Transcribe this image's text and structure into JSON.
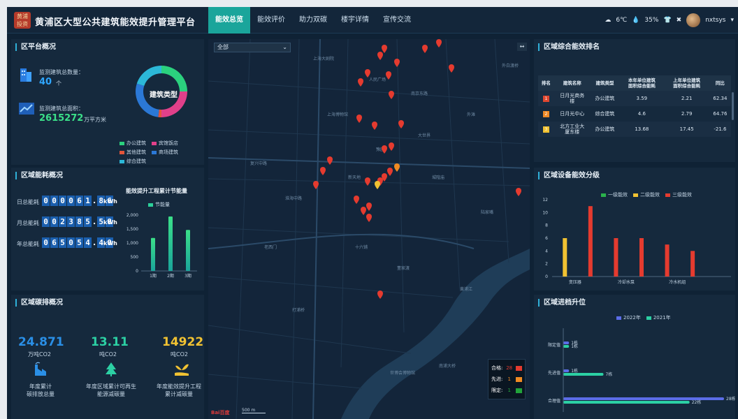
{
  "header": {
    "logo_text": "黄浦\n投资",
    "title": "黄浦区大型公共建筑能效提升管理平台",
    "nav": [
      "能效总览",
      "能效评价",
      "助力双碳",
      "楼宇详情",
      "宣传交流"
    ],
    "weather": "6℃",
    "humidity": "35%",
    "username": "nxtsys"
  },
  "overview": {
    "title": "区平台概况",
    "building_count_label": "监测建筑总数量：",
    "building_count": "40",
    "building_count_unit": "个",
    "area_label": "监测建筑总面积：",
    "area": "2615272",
    "area_unit": "万平方米",
    "donut_label": "建筑类型",
    "donut": [
      {
        "name": "办公建筑",
        "value": 25,
        "color": "#2bd17e"
      },
      {
        "name": "宾馆饭店",
        "value": 25,
        "color": "#e0408a"
      },
      {
        "name": "其他建筑",
        "value": 2,
        "color": "#e2553a"
      },
      {
        "name": "商场建筑",
        "value": 28,
        "color": "#2b78d6"
      },
      {
        "name": "综合建筑",
        "value": 20,
        "color": "#2cb8d8"
      }
    ]
  },
  "energy": {
    "title": "区域能耗概况",
    "daily_label": "日总能耗",
    "daily": "000061.86",
    "monthly_label": "月总能耗",
    "monthly": "002385.58",
    "yearly_label": "年总能耗",
    "yearly": "065054.40",
    "unit": "kWh",
    "chart_title": "能效提升工程累计节能量",
    "legend": "节能量"
  },
  "carbon": {
    "title": "区域碳排概况",
    "items": [
      {
        "value": "24.871",
        "unit": "万吨CO2",
        "label": "年度累计\n碳排放总量",
        "color": "#2a8fe6"
      },
      {
        "value": "13.11",
        "unit": "吨CO2",
        "label": "年度区域累计可再生\n能源减碳量",
        "color": "#2cd0a4"
      },
      {
        "value": "14922",
        "unit": "吨CO2",
        "label": "年度能效提升工程\n累计减碳量",
        "color": "#f1c232"
      }
    ]
  },
  "map": {
    "select_value": "全部",
    "legend": [
      {
        "label": "合格:",
        "count": "28",
        "color": "#e53b2f"
      },
      {
        "label": "先进:",
        "count": "1",
        "color": "#f08a22"
      },
      {
        "label": "限定:",
        "count": "1",
        "color": "#21a33a"
      }
    ],
    "scale_label": "500 m",
    "labels": [
      "上海大剧院",
      "人民广场",
      "南京东路",
      "外滩",
      "豫园",
      "新天地",
      "淮海中路",
      "陆家嘴",
      "黄浦江",
      "世博会博物馆",
      "大世界",
      "上海博物馆",
      "老西门",
      "打浦桥",
      "董家渡",
      "南浦大桥",
      "复兴中路",
      "城隍庙",
      "十六铺",
      "外白渡桥"
    ]
  },
  "ranking": {
    "title": "区域综合能效排名",
    "columns": [
      "排名",
      "建筑名称",
      "建筑类型",
      "本年单位建筑\n面积综合能耗",
      "上年单位建筑\n面积综合能耗",
      "同比"
    ],
    "rows": [
      {
        "rank": "1",
        "name": "日月光商务\n楼",
        "type": "办公建筑",
        "this_year": "3.59",
        "last_year": "2.21",
        "yoy": "62.34",
        "color": "#e0472f"
      },
      {
        "rank": "2",
        "name": "日月光中心",
        "type": "综合建筑",
        "this_year": "4.6",
        "last_year": "2.79",
        "yoy": "64.76",
        "color": "#ef8a26"
      },
      {
        "rank": "3",
        "name": "北方工业大\n厦东楼",
        "type": "办公建筑",
        "this_year": "13.68",
        "last_year": "17.45",
        "yoy": "-21.6",
        "color": "#f1c232"
      }
    ]
  },
  "levels": {
    "title": "区域设备能效分级",
    "legend": [
      "一级能效",
      "二级能效",
      "三级能效"
    ]
  },
  "upgrade": {
    "title": "区域进档升位",
    "legend": [
      "2022年",
      "2021年"
    ]
  },
  "chart_data": [
    {
      "type": "bar",
      "title": "能效提升工程累计节能量",
      "categories": [
        "1期",
        "2期",
        "3期"
      ],
      "series": [
        {
          "name": "节能量",
          "values": [
            1180,
            1950,
            1470
          ]
        }
      ],
      "ylim": [
        0,
        2000
      ],
      "yticks": [
        0,
        500,
        1000,
        1500,
        2000
      ],
      "legend": "top"
    },
    {
      "type": "bar",
      "title": "区域设备能效分级",
      "categories": [
        "",
        "变压器",
        "",
        "冷却水泵",
        "",
        "冷水机组",
        ""
      ],
      "tick_labels": [
        "变压器",
        "冷却水泵",
        "冷水机组"
      ],
      "series": [
        {
          "name": "一级能效",
          "color": "#2bb24c",
          "values": [
            0,
            0,
            0,
            0,
            0,
            0,
            0
          ]
        },
        {
          "name": "二级能效",
          "color": "#f1c232",
          "values": [
            6,
            0,
            0,
            0,
            0,
            0,
            0
          ]
        },
        {
          "name": "三级能效",
          "color": "#e53b2f",
          "values": [
            0,
            11,
            6,
            6,
            5,
            4,
            0
          ]
        }
      ],
      "ylim": [
        0,
        12
      ],
      "yticks": [
        0,
        2,
        4,
        6,
        8,
        10,
        12
      ],
      "legend": "top"
    },
    {
      "type": "bar",
      "orientation": "horizontal",
      "title": "区域进档升位",
      "categories": [
        "限定值",
        "先进值",
        "合理值"
      ],
      "series": [
        {
          "name": "2022年",
          "color": "#5b6de8",
          "values": [
            1,
            1,
            28
          ],
          "labels": [
            "1栋",
            "1栋",
            "28栋"
          ]
        },
        {
          "name": "2021年",
          "color": "#2cd0a4",
          "values": [
            1,
            7,
            22
          ],
          "labels": [
            "1栋",
            "7栋",
            "22栋"
          ]
        }
      ],
      "xlim": [
        0,
        28
      ],
      "legend": "top"
    }
  ]
}
